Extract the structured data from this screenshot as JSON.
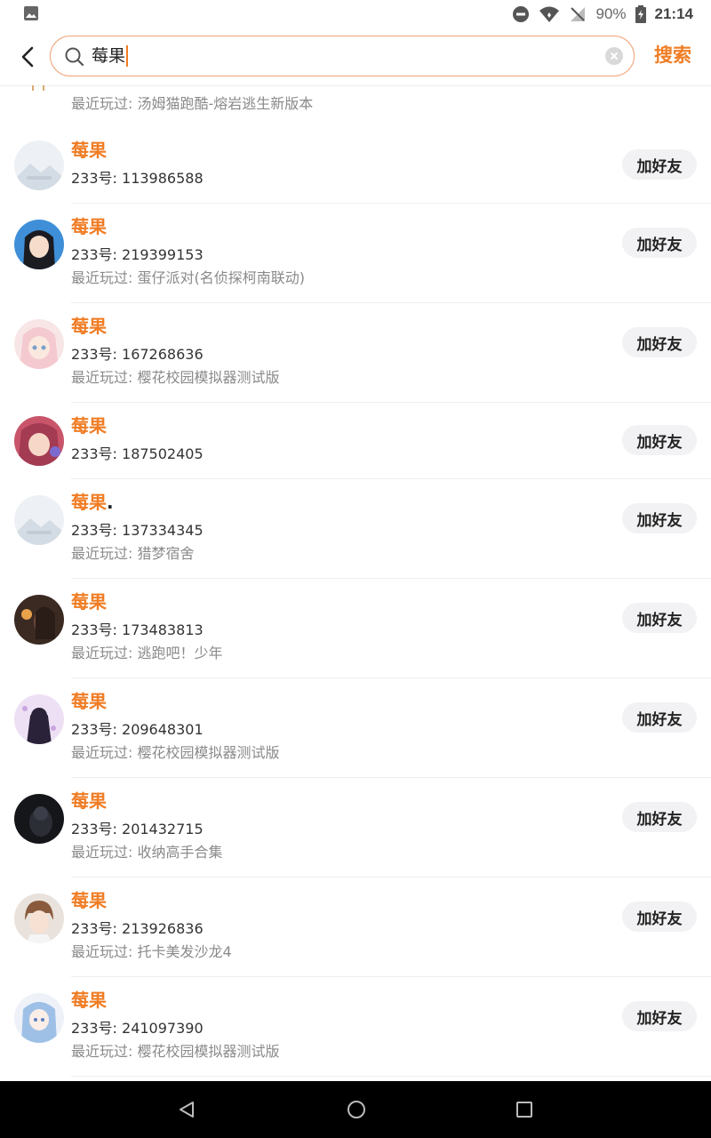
{
  "status_bar": {
    "battery": "90%",
    "time": "21:14"
  },
  "search": {
    "query": "莓果",
    "button": "搜索"
  },
  "partial_row": {
    "recent": "最近玩过: 汤姆猫跑酷-熔岩逃生新版本"
  },
  "colors": {
    "accent": "#f07d25",
    "navbar": "#000000"
  },
  "results": [
    {
      "name": "莓果",
      "suffix": "",
      "uid": "233号: 113986588",
      "recent": "",
      "avatar": "default-mountain",
      "button": "加好友"
    },
    {
      "name": "莓果",
      "suffix": "",
      "uid": "233号: 219399153",
      "recent": "最近玩过: 蛋仔派对(名侦探柯南联动)",
      "avatar": "anime-girl-blue",
      "button": "加好友"
    },
    {
      "name": "莓果",
      "suffix": "",
      "uid": "233号: 167268636",
      "recent": "最近玩过: 樱花校园模拟器测试版",
      "avatar": "anime-girl-pink",
      "button": "加好友"
    },
    {
      "name": "莓果",
      "suffix": "",
      "uid": "233号: 187502405",
      "recent": "",
      "avatar": "anime-girl-red",
      "button": "加好友"
    },
    {
      "name": "莓果",
      "suffix": ".",
      "uid": "233号: 137334345",
      "recent": "最近玩过: 猎梦宿舍",
      "avatar": "default-mountain",
      "button": "加好友"
    },
    {
      "name": "莓果",
      "suffix": "",
      "uid": "233号: 173483813",
      "recent": "最近玩过: 逃跑吧！少年",
      "avatar": "dark-portrait",
      "button": "加好友"
    },
    {
      "name": "莓果",
      "suffix": "",
      "uid": "233号: 209648301",
      "recent": "最近玩过: 樱花校园模拟器测试版",
      "avatar": "purple-silhouette",
      "button": "加好友"
    },
    {
      "name": "莓果",
      "suffix": "",
      "uid": "233号: 201432715",
      "recent": "最近玩过: 收纳高手合集",
      "avatar": "dark-photo",
      "button": "加好友"
    },
    {
      "name": "莓果",
      "suffix": "",
      "uid": "233号: 213926836",
      "recent": "最近玩过: 托卡美发沙龙4",
      "avatar": "anime-boy",
      "button": "加好友"
    },
    {
      "name": "莓果",
      "suffix": "",
      "uid": "233号: 241097390",
      "recent": "最近玩过: 樱花校园模拟器测试版",
      "avatar": "anime-girl-lightblue",
      "button": "加好友"
    }
  ]
}
